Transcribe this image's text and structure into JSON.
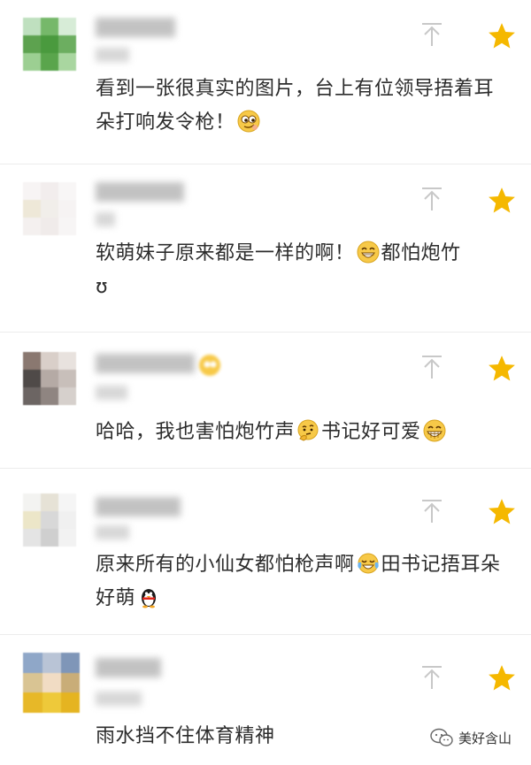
{
  "comments": [
    {
      "text_parts": [
        "看到一张很真实的图片，台上有位领导捂着耳朵打响发令枪！",
        ""
      ],
      "emojis": [
        "smirk-face-icon"
      ]
    },
    {
      "text_parts": [
        "软萌妹子原来都是一样的啊！",
        "都怕炮竹",
        "ʊ"
      ],
      "emojis": [
        "grin-face-icon"
      ]
    },
    {
      "text_parts": [
        "哈哈，我也害怕炮竹声",
        "书记好可爱",
        ""
      ],
      "emojis": [
        "thinking-face-icon",
        "grin-face-icon"
      ]
    },
    {
      "text_parts": [
        "原来所有的小仙女都怕枪声啊",
        "田书记捂耳朵好萌",
        ""
      ],
      "emojis": [
        "tears-of-joy-icon",
        "penguin-icon"
      ]
    },
    {
      "text_parts": [
        "雨水挡不住体育精神"
      ],
      "emojis": []
    }
  ],
  "watermark": {
    "label": "美好含山"
  },
  "colors": {
    "star": "#f5b800",
    "arrow": "#c8c8c8",
    "text": "#2c2c2c"
  }
}
